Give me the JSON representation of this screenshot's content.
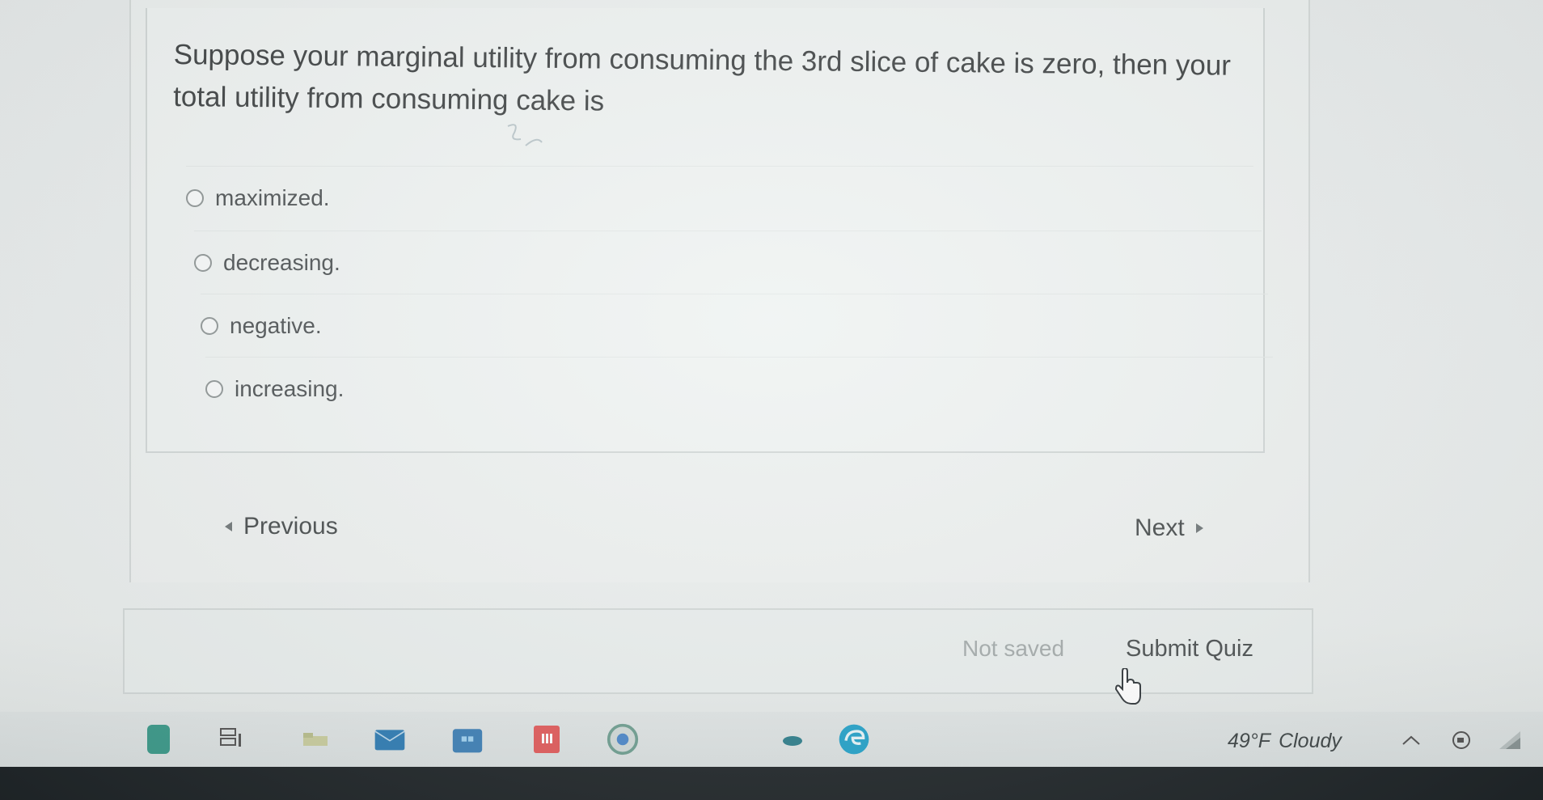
{
  "question": {
    "text": "Suppose your marginal utility from consuming the 3rd slice of cake is zero, then your total utility from consuming cake is"
  },
  "answers": [
    {
      "label": "maximized."
    },
    {
      "label": "decreasing."
    },
    {
      "label": "negative."
    },
    {
      "label": "increasing."
    }
  ],
  "navigation": {
    "previous_label": "Previous",
    "next_label": "Next"
  },
  "footer": {
    "status": "Not saved",
    "submit_label": "Submit Quiz"
  },
  "taskbar": {
    "icons": [
      "start-icon",
      "task-view-icon",
      "file-explorer-icon",
      "mail-icon",
      "store-icon",
      "office-icon",
      "chrome-icon",
      "edge-icon"
    ],
    "weather_temp": "49°F",
    "weather_condition": "Cloudy"
  },
  "colors": {
    "background": "#e9eded",
    "text": "#3d4142",
    "muted": "#a3aaaa",
    "taskbar": "#dbe1e1",
    "bezel": "#1f2528"
  }
}
